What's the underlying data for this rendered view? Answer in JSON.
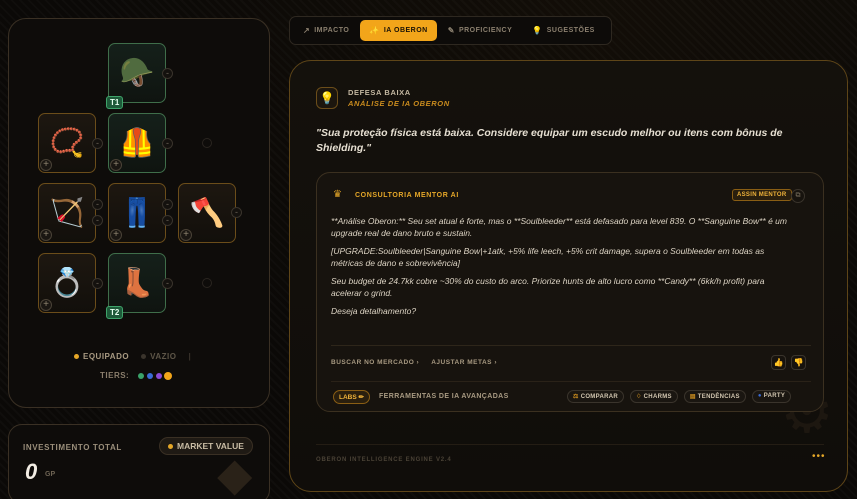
{
  "equipment": {
    "slots": [
      {
        "id": "helmet",
        "icon": "helmet-icon",
        "glyph": "🪖",
        "tier": "T1"
      },
      {
        "id": "amulet",
        "icon": "amulet-icon",
        "glyph": "📿"
      },
      {
        "id": "armor",
        "icon": "armor-icon",
        "glyph": "🦺"
      },
      {
        "id": "weapon",
        "icon": "bow-icon",
        "glyph": "🏹"
      },
      {
        "id": "legs",
        "icon": "legs-icon",
        "glyph": "👖"
      },
      {
        "id": "shield",
        "icon": "shield-icon",
        "glyph": "🪓"
      },
      {
        "id": "ring",
        "icon": "ring-icon",
        "glyph": "💍"
      },
      {
        "id": "boots",
        "icon": "boots-icon",
        "glyph": "👢",
        "tier": "T2"
      }
    ],
    "legend_equipped": "EQUIPADO",
    "legend_empty": "VAZIO",
    "tiers_label": "TIERS:",
    "tier_colors": [
      "#3aa36a",
      "#3a6bd6",
      "#8a4ad6",
      "#f2a51a"
    ]
  },
  "investment": {
    "label": "INVESTIMENTO TOTAL",
    "market_value": "MARKET VALUE",
    "value": "0",
    "unit": "GP"
  },
  "tabs": [
    {
      "label": "IMPACTO",
      "icon": "trend-icon",
      "glyph": "↗",
      "active": false
    },
    {
      "label": "IA OBERON",
      "icon": "sparkle-icon",
      "glyph": "✨",
      "active": true
    },
    {
      "label": "PROFICIENCY",
      "icon": "wrench-icon",
      "glyph": "✎",
      "active": false
    },
    {
      "label": "SUGESTÕES",
      "icon": "lightbulb-icon",
      "glyph": "💡",
      "active": false
    }
  ],
  "insight": {
    "title": "DEFESA BAIXA",
    "subtitle": "ANÁLISE DE IA OBERON",
    "quote": "\"Sua proteção física está baixa. Considere equipar um escudo melhor ou itens com bônus de Shielding.\""
  },
  "mentor": {
    "title": "CONSULTORIA MENTOR AI",
    "assign_label": "ASSIN MENTOR",
    "paragraphs": [
      "**Análise Oberon:** Seu set atual é forte, mas o **Soulbleeder** está defasado para level 839. O **Sanguine Bow** é um upgrade real de dano bruto e sustain.",
      "[UPGRADE:Soulbleeder|Sanguine Bow|+1atk, +5% life leech, +5% crit damage, supera o Soulbleeder em todas as métricas de dano e sobrevivência]",
      "Seu budget de 24.7kk cobre ~30% do custo do arco. Priorize hunts de alto lucro como **Candy** (6kk/h profit) para acelerar o grind.",
      "Deseja detalhamento?"
    ],
    "actions": [
      "BUSCAR NO MERCADO  ›",
      "AJUSTAR METAS  ›"
    ],
    "labs_label": "LABS ✏",
    "labs_text": "FERRAMENTAS DE IA AVANÇADAS",
    "tools": [
      {
        "label": "COMPARAR",
        "icon": "compare-icon",
        "glyph": "⚖"
      },
      {
        "label": "CHARMS",
        "icon": "charm-icon",
        "glyph": "♢"
      },
      {
        "label": "TENDÊNCIAS",
        "icon": "chart-icon",
        "glyph": "▤"
      },
      {
        "label": "PARTY",
        "icon": "party-icon",
        "glyph": "●"
      }
    ]
  },
  "footer": {
    "engine_text": "OBERON INTELLIGENCE ENGINE V2.4",
    "dots": "•••"
  }
}
